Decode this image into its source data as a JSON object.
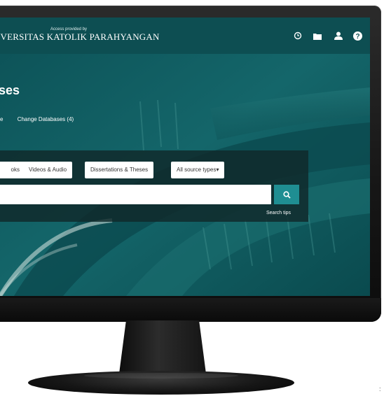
{
  "header": {
    "access_note": "Access provided by",
    "org_name": "IVERSITAS KATOLIK PARAHYANGAN",
    "icons": [
      "history-icon",
      "folder-icon",
      "user-icon",
      "help-icon"
    ]
  },
  "main": {
    "title": "ses",
    "links": [
      "e",
      "Change Databases (4)"
    ]
  },
  "search": {
    "source_types": [
      "oks",
      "Videos & Audio",
      "Dissertations & Theses",
      "All source types▾"
    ],
    "query_value": "",
    "tips_label": "Search tips"
  },
  "monitor": {
    "edge_mark": ":"
  },
  "colors": {
    "header_bg": "#0d4e52",
    "screen_bg": "#0e5a5f",
    "button": "#1f8e92"
  }
}
